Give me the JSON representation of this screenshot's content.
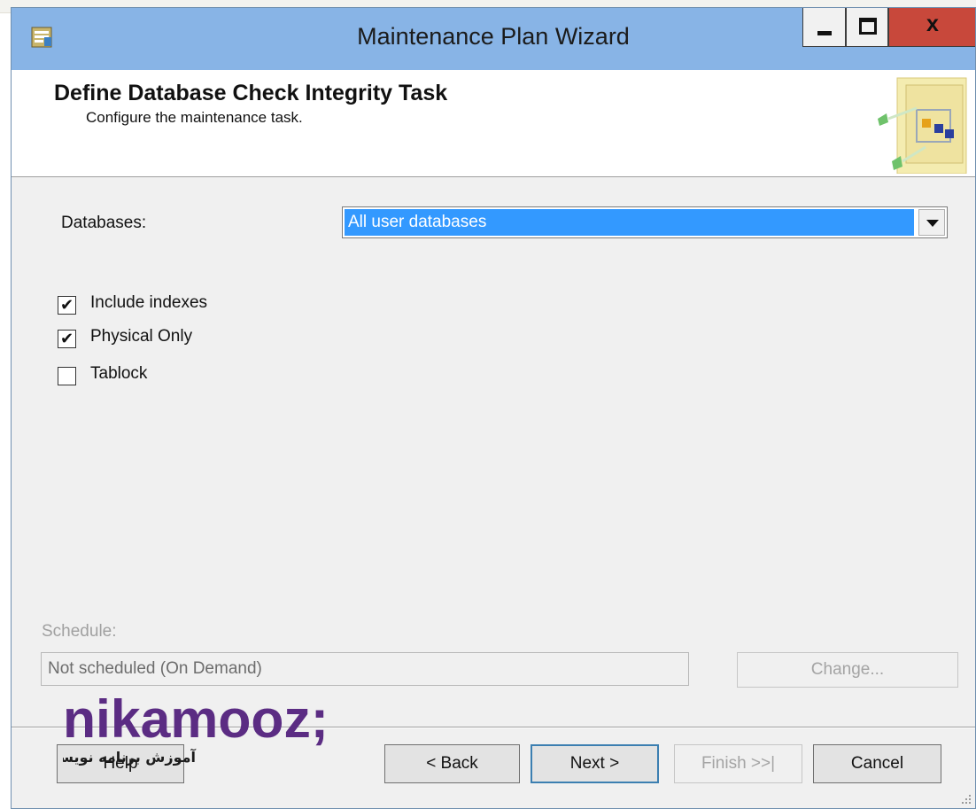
{
  "window": {
    "title": "Maintenance Plan Wizard",
    "close_glyph": "x"
  },
  "header": {
    "title": "Define Database Check Integrity Task",
    "subtitle": "Configure the maintenance task."
  },
  "databases": {
    "label": "Databases:",
    "value": "All user databases"
  },
  "options": [
    {
      "label": "Include indexes",
      "checked": true
    },
    {
      "label": "Physical Only",
      "checked": true
    },
    {
      "label": "Tablock",
      "checked": false
    }
  ],
  "schedule": {
    "label": "Schedule:",
    "value": "Not scheduled (On Demand)",
    "change_label": "Change..."
  },
  "buttons": {
    "help": "Help",
    "back": "< Back",
    "next": "Next >",
    "finish": "Finish >>|",
    "cancel": "Cancel"
  },
  "watermark": {
    "brand": "nikamooz;",
    "tagline": "آموزش برنامه نویسی"
  },
  "colors": {
    "titlebar": "#88b4e6",
    "close_button": "#c8483b",
    "selection": "#3399ff",
    "watermark": "#5b2c83"
  },
  "icons": {
    "app": "maintenance-plan-icon",
    "header": "wizard-header-icon",
    "checkmark": "✔"
  }
}
